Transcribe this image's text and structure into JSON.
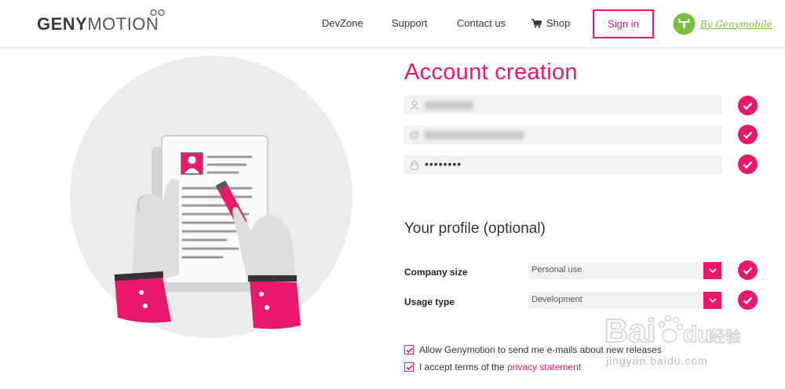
{
  "header": {
    "logo_bold": "GENY",
    "logo_light": "MOTION",
    "nav": [
      "DevZone",
      "Support",
      "Contact us",
      "Shop"
    ],
    "signin_label": "Sign in",
    "by_genymobile": "By Genymobile"
  },
  "form": {
    "title": "Account creation",
    "password_mask": "••••••••"
  },
  "profile": {
    "title": "Your profile (optional)",
    "company_size_label": "Company size",
    "company_size_value": "Personal use",
    "usage_type_label": "Usage type",
    "usage_type_value": "Development"
  },
  "checkboxes": {
    "allow_emails": "Allow Genymotion to send me e-mails about new releases",
    "accept_terms": "I accept terms of the",
    "privacy_link": "privacy statement"
  },
  "watermark": {
    "brand": "Bai",
    "du": "du",
    "cn": "经验",
    "url": "jingyan.baidu.com"
  },
  "colors": {
    "accent": "#e6196b",
    "genymobile_green": "#7bbd43"
  }
}
